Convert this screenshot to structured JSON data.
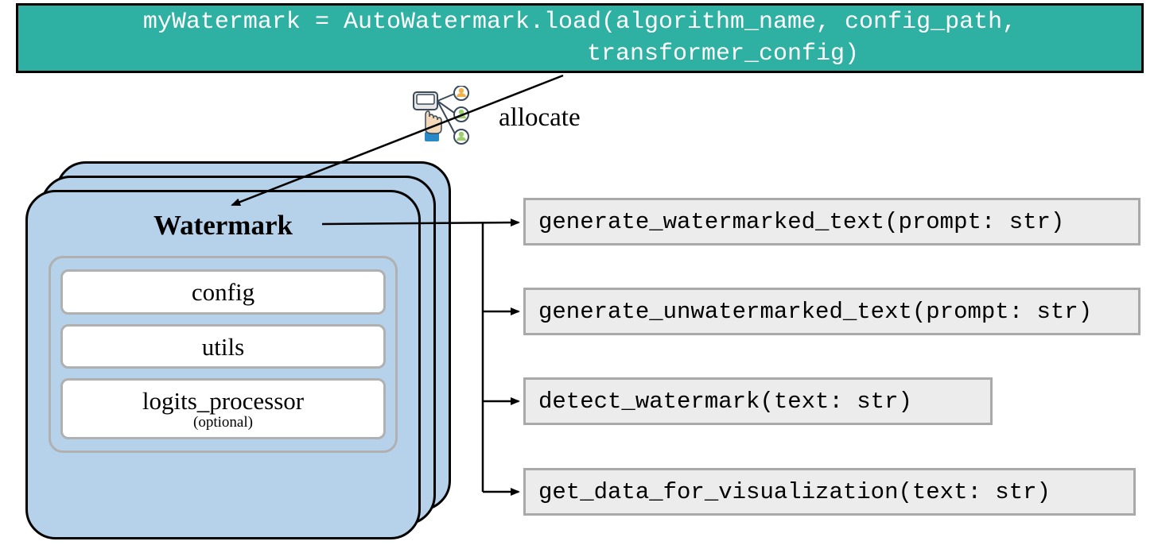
{
  "code_banner": "myWatermark = AutoWatermark.load(algorithm_name, config_path,\n                    transformer_config)",
  "allocate_label": "allocate",
  "card": {
    "title": "Watermark",
    "items": {
      "config": "config",
      "utils": "utils",
      "logits_processor": "logits_processor",
      "optional_note": "(optional)"
    }
  },
  "methods": {
    "m1": "generate_watermarked_text(prompt: str)",
    "m2": "generate_unwatermarked_text(prompt: str)",
    "m3": "detect_watermark(text: str)",
    "m4": "get_data_for_visualization(text: str)"
  }
}
